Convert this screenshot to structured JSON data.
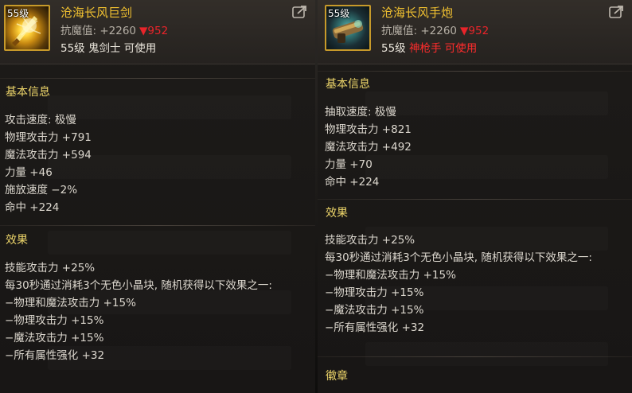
{
  "left": {
    "icon": "greatsword-item-icon",
    "level_tag": "55级",
    "name": "沧海长风巨剑",
    "resist_label": "抗魔值: +2260",
    "resist_down": "▼952",
    "req_level": "55级",
    "req_class": "鬼剑士",
    "req_usable": "可使用",
    "basic_title": "基本信息",
    "basic_stats": [
      "攻击速度: 极慢",
      "物理攻击力 +791",
      "魔法攻击力 +594",
      "力量 +46",
      "施放速度 −2%",
      "命中 +224"
    ],
    "effect_title": "效果",
    "effects": [
      "技能攻击力 +25%",
      "每30秒通过消耗3个无色小晶块, 随机获得以下效果之一:",
      "−物理和魔法攻击力 +15%",
      "−物理攻击力 +15%",
      "−魔法攻击力 +15%",
      "−所有属性强化 +32"
    ]
  },
  "right": {
    "icon": "handcannon-item-icon",
    "level_tag": "55级",
    "name": "沧海长风手炮",
    "resist_label": "抗魔值: +2260",
    "resist_down": "▼952",
    "req_level": "55级",
    "req_class": "神枪手",
    "req_usable": "可使用",
    "basic_title": "基本信息",
    "basic_stats": [
      "抽取速度: 极慢",
      "物理攻击力 +821",
      "魔法攻击力 +492",
      "力量 +70",
      "命中 +224"
    ],
    "effect_title": "效果",
    "effects": [
      "技能攻击力 +25%",
      "每30秒通过消耗3个无色小晶块, 随机获得以下效果之一:",
      "−物理和魔法攻击力 +15%",
      "−物理攻击力 +15%",
      "−魔法攻击力 +15%",
      "−所有属性强化 +32"
    ],
    "badge_title": "徽章"
  },
  "colors": {
    "name_gold": "#f0c030",
    "section_gold": "#eed66a",
    "down_red": "#e8242a",
    "class_red": "#ff2c2c",
    "frame_gold": "#c79a2a"
  }
}
